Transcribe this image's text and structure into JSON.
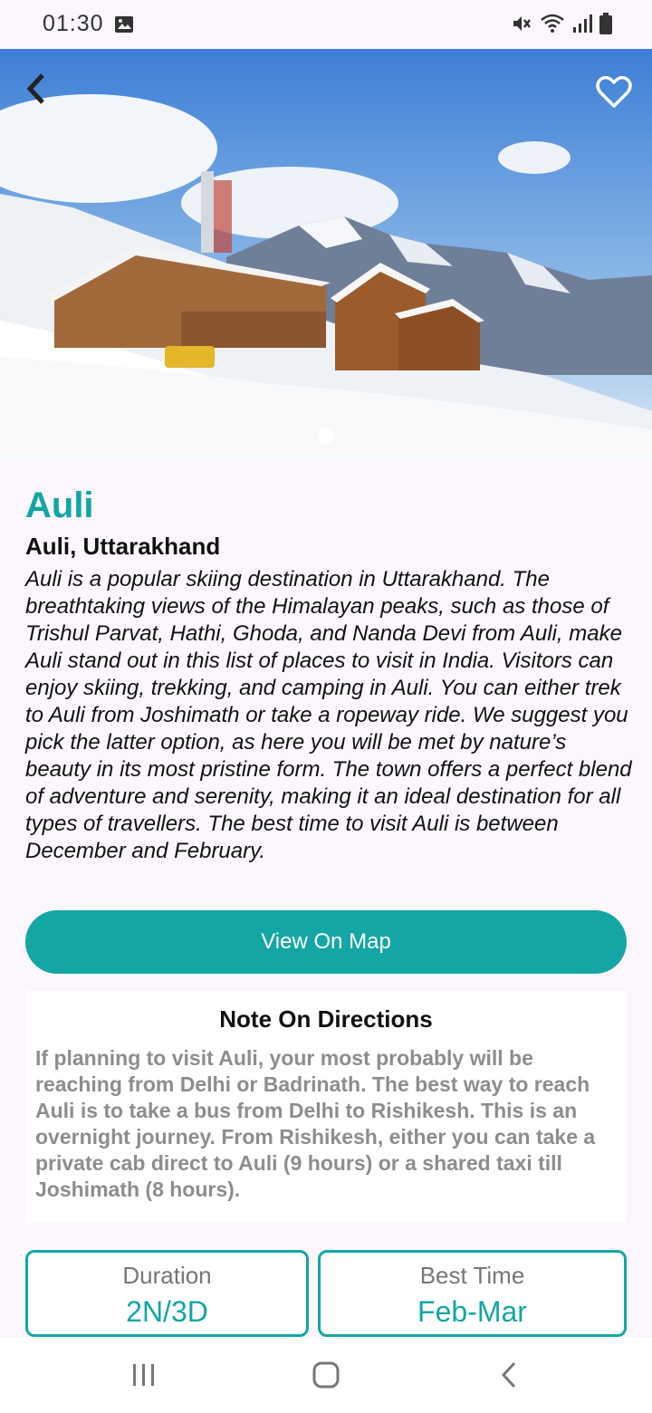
{
  "status_bar": {
    "time": "01:30",
    "icons": [
      "image-icon",
      "mute-icon",
      "wifi-icon",
      "signal-icon",
      "battery-icon"
    ]
  },
  "hero": {
    "image_description": "snow-covered mountain resort",
    "page_index": 1,
    "page_count": 1
  },
  "place": {
    "title": "Auli",
    "location": "Auli, Uttarakhand",
    "description": "Auli is a popular skiing destination in Uttarakhand. The breathtaking views of the Himalayan peaks, such as those of Trishul Parvat, Hathi, Ghoda, and Nanda Devi from Auli, make Auli stand out in this list of places to visit in India. Visitors can enjoy skiing, trekking, and camping in Auli. You can either trek to Auli from Joshimath or take a ropeway ride. We suggest you pick the latter option, as here you will be met by nature’s beauty in its most pristine form. The town offers a perfect blend of adventure and serenity, making it an ideal destination for all types of travellers. The best time to visit Auli is between December and February."
  },
  "actions": {
    "view_on_map": "View On Map"
  },
  "note": {
    "title": "Note On Directions",
    "body": "If planning to visit Auli, your most probably will be reaching from Delhi or Badrinath. The best way to reach Auli is to take a bus from Delhi to Rishikesh. This is an overnight journey. From Rishikesh, either you can take a private cab direct to Auli (9 hours) or a shared taxi till Joshimath (8 hours)."
  },
  "info": {
    "duration_label": "Duration",
    "duration_value": "2N/3D",
    "best_time_label": "Best Time",
    "best_time_value": "Feb-Mar"
  },
  "colors": {
    "accent": "#13a6a5",
    "background": "#fbf7fd",
    "note_text": "#8d8d8d"
  },
  "nav_bar": {
    "icons": [
      "recent-apps-icon",
      "home-icon",
      "back-icon"
    ]
  }
}
